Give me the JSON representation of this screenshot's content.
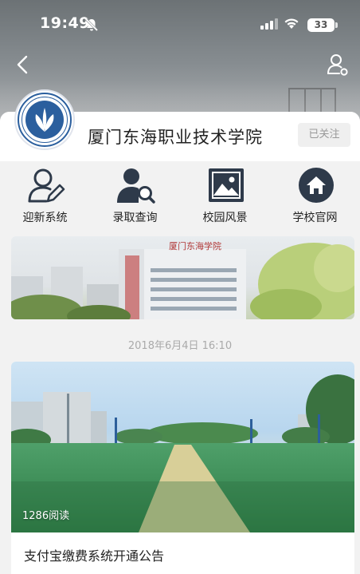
{
  "status_bar": {
    "time": "19:49",
    "battery": "33"
  },
  "header": {
    "back_icon": "chevron-left-icon",
    "profile_icon": "user-settings-icon"
  },
  "account": {
    "name": "厦门东海职业技术学院",
    "follow_label": "已关注"
  },
  "menu": {
    "items": [
      {
        "label": "迎新系统",
        "icon": "user-edit-icon"
      },
      {
        "label": "录取查询",
        "icon": "user-search-icon"
      },
      {
        "label": "校园风景",
        "icon": "image-icon"
      },
      {
        "label": "学校官网",
        "icon": "home-icon"
      }
    ]
  },
  "banner": {
    "building_sign": "厦门东海学院"
  },
  "feed": {
    "date": "2018年6月4日  16:10",
    "article": {
      "reads": "1286阅读",
      "title": "支付宝缴费系统开通公告"
    }
  },
  "colors": {
    "accent_blue": "#2b5f9e",
    "icon_dark": "#2e3a4a",
    "follow_gray": "#999999"
  }
}
